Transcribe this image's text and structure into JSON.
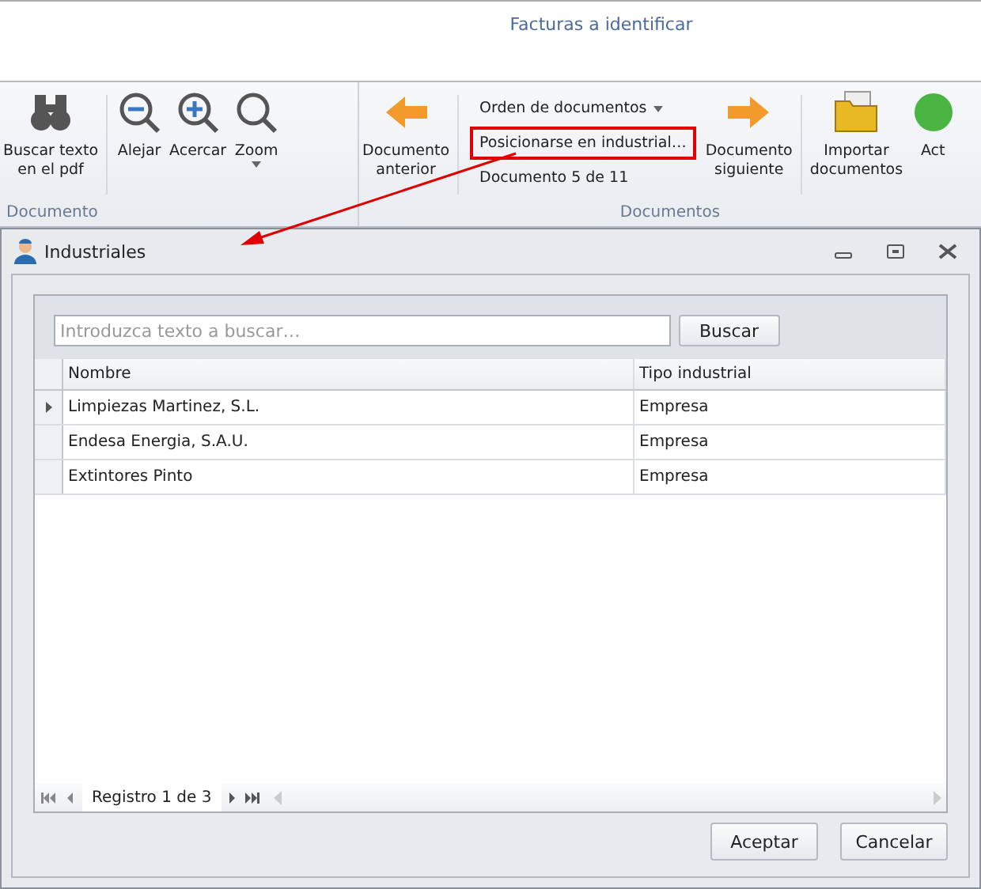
{
  "window": {
    "title": "Facturas a identificar"
  },
  "ribbon": {
    "groups": [
      {
        "label": "Documento",
        "items": [
          {
            "kind": "large",
            "label": "Buscar texto\nen el pdf",
            "dropdown": false
          },
          {
            "kind": "separator"
          },
          {
            "kind": "large",
            "label": "Alejar",
            "dropdown": false
          },
          {
            "kind": "large",
            "label": "Acercar",
            "dropdown": false
          },
          {
            "kind": "large",
            "label": "Zoom",
            "dropdown": true
          }
        ]
      },
      {
        "label": "Documentos",
        "items": [
          {
            "kind": "large",
            "label": "Documento\nanterior",
            "dropdown": false
          },
          {
            "kind": "separator"
          },
          {
            "kind": "stack",
            "entries": [
              {
                "label": "Orden de documentos",
                "dropdown": true,
                "highlighted": false
              },
              {
                "label": "Posicionarse en industrial…",
                "dropdown": false,
                "highlighted": true
              },
              {
                "label": "Documento 5 de 11",
                "dropdown": false,
                "highlighted": false
              }
            ]
          },
          {
            "kind": "large",
            "label": "Documento\nsiguiente",
            "dropdown": false
          },
          {
            "kind": "separator"
          },
          {
            "kind": "large",
            "label": "Importar\ndocumentos",
            "dropdown": false
          },
          {
            "kind": "large",
            "label": "Act",
            "dropdown": false
          }
        ]
      }
    ]
  },
  "dialog": {
    "title": "Industriales",
    "search": {
      "placeholder": "Introduzca texto a buscar…",
      "button": "Buscar"
    },
    "table": {
      "columns": [
        "Nombre",
        "Tipo industrial"
      ],
      "rows": [
        {
          "cells": [
            "Limpiezas Martinez, S.L.",
            "Empresa"
          ],
          "selected": true
        },
        {
          "cells": [
            "Endesa Energia, S.A.U.",
            "Empresa"
          ],
          "selected": false
        },
        {
          "cells": [
            "Extintores Pinto",
            "Empresa"
          ],
          "selected": false
        }
      ]
    },
    "navigator": {
      "text": "Registro 1 de 3"
    },
    "buttons": [
      "Aceptar",
      "Cancelar"
    ]
  }
}
